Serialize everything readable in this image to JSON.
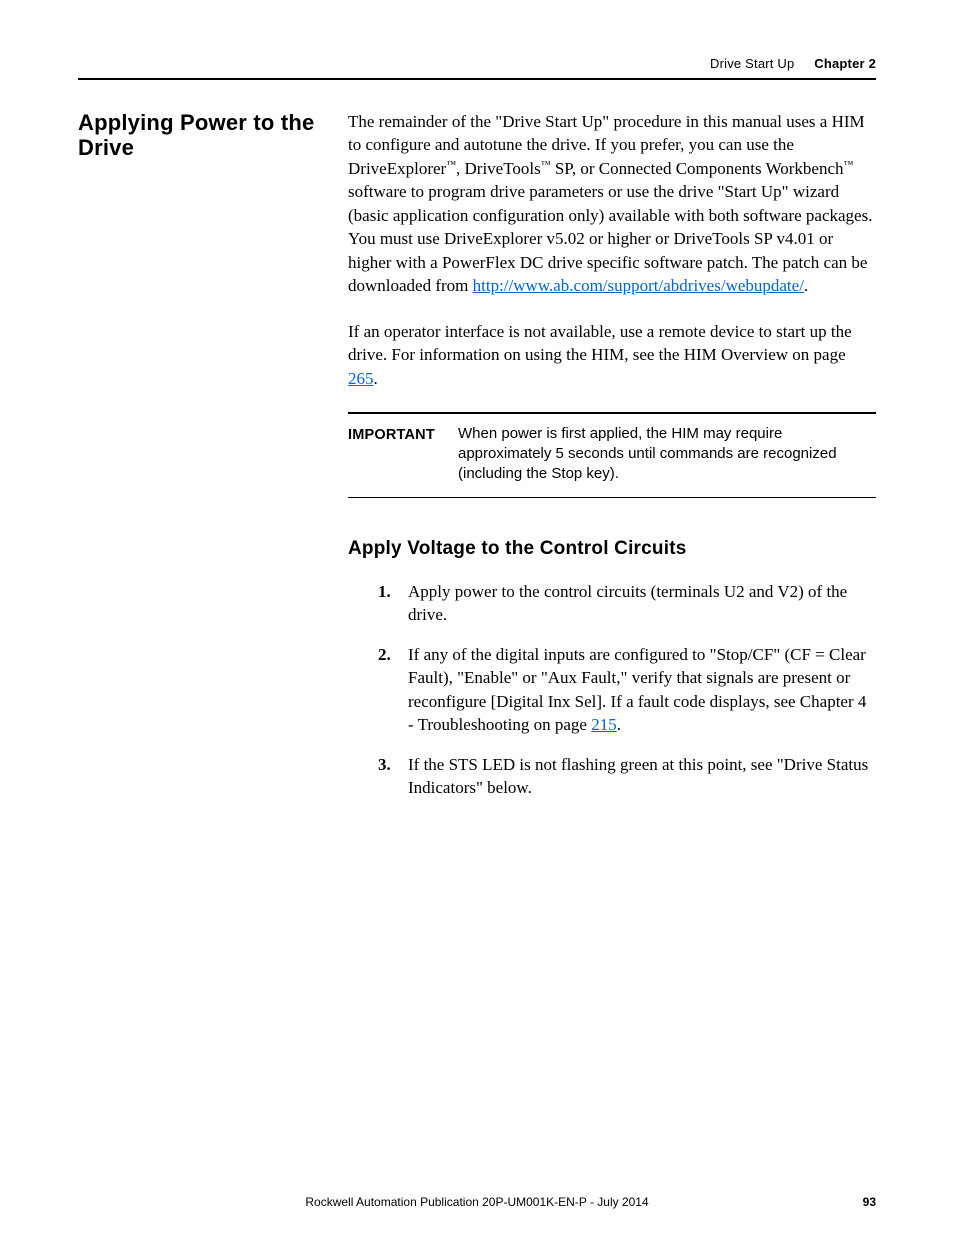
{
  "header": {
    "section": "Drive Start Up",
    "chapter": "Chapter 2"
  },
  "sidehead": "Applying Power to the Drive",
  "para1": {
    "t1": "The remainder of the \"Drive Start Up\" procedure in this manual uses a HIM to configure and autotune the drive. If you prefer, you can use the DriveExplorer",
    "tm1": "™",
    "t2": ", DriveTools",
    "tm2": "™",
    "t3": " SP, or Connected Components Workbench",
    "tm3": "™",
    "t4": " software to program drive parameters or use the drive \"Start Up\" wizard (basic application configuration only) available with both software packages. You must use DriveExplorer v5.02 or higher or DriveTools SP v4.01 or higher with a PowerFlex DC drive specific software patch. The patch can be downloaded from ",
    "link1a": "http://",
    "link1b": "www.ab.com/support/abdrives/webupdate/",
    "t5": "."
  },
  "para2": {
    "t1": "If an operator interface is not available, use a remote device to start up the drive. For information on using the HIM, see the HIM Overview on page ",
    "link": "265",
    "t2": "."
  },
  "important": {
    "label": "IMPORTANT",
    "text": "When power is first applied, the HIM may require approximately 5 seconds until commands are recognized (including the Stop key)."
  },
  "subhead": "Apply Voltage to the Control Circuits",
  "steps": {
    "s1": "Apply power to the control circuits (terminals U2 and V2) of the drive.",
    "s2a": "If any of the digital inputs are configured to \"Stop/CF\" (CF = Clear Fault), \"Enable\" or \"Aux Fault,\" verify that signals are present or reconfigure [Digital Inx Sel]. If a fault code displays, see Chapter 4 - Troubleshooting on page ",
    "s2link": "215",
    "s2b": ".",
    "s3": "If the STS LED is not flashing green at this point, see \"Drive Status Indicators\" below."
  },
  "footer": {
    "pub": "Rockwell Automation Publication 20P-UM001K-EN-P - July 2014",
    "page": "93"
  }
}
